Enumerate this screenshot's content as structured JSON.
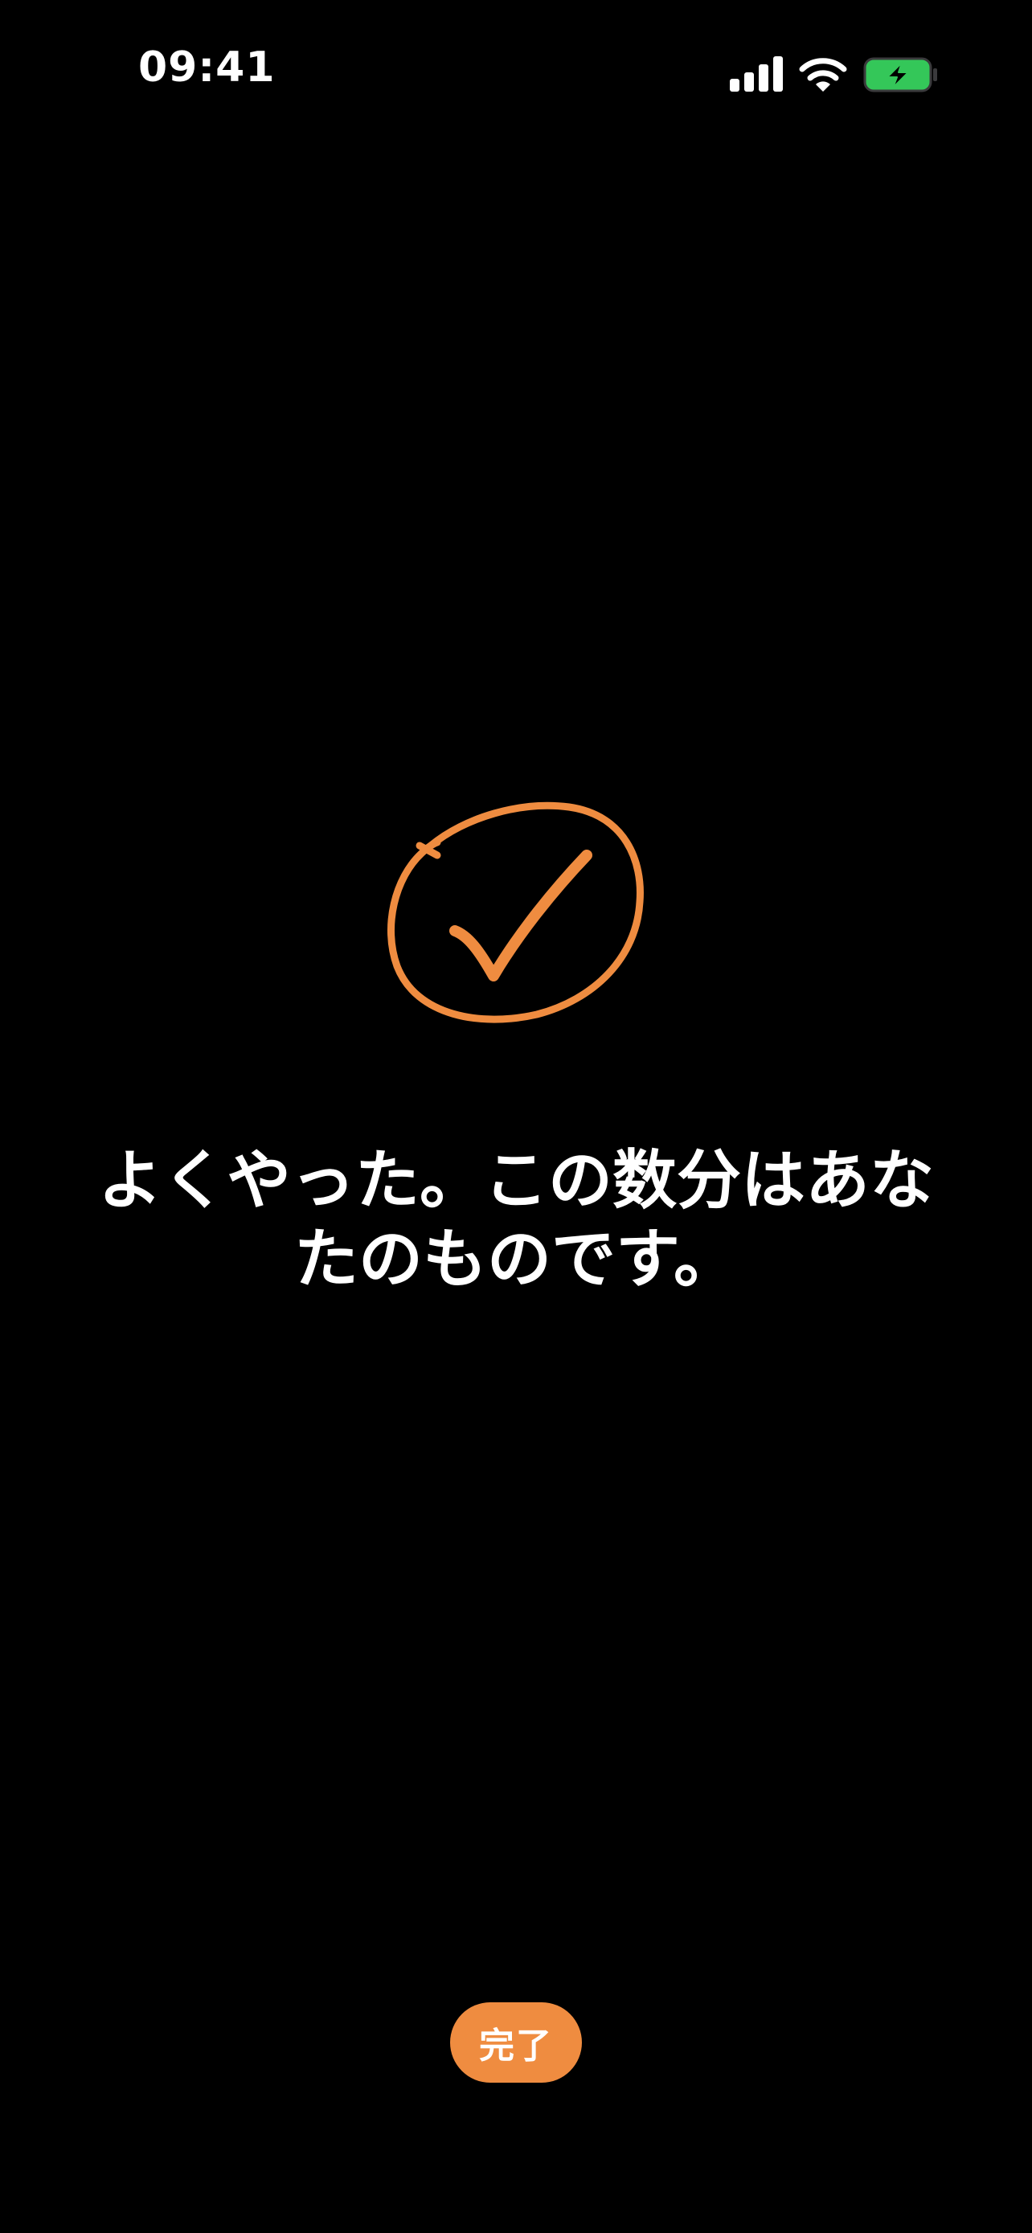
{
  "status_bar": {
    "time": "09:41",
    "signal_icon": "cellular-signal-icon",
    "wifi_icon": "wifi-icon",
    "battery_icon": "battery-charging-icon",
    "battery_color": "#34c759"
  },
  "main": {
    "check_icon": "circled-checkmark-icon",
    "message": "よくやった。この数分はあなたのものです。",
    "accent_color": "#ef8c40"
  },
  "footer": {
    "done_label": "完了"
  }
}
